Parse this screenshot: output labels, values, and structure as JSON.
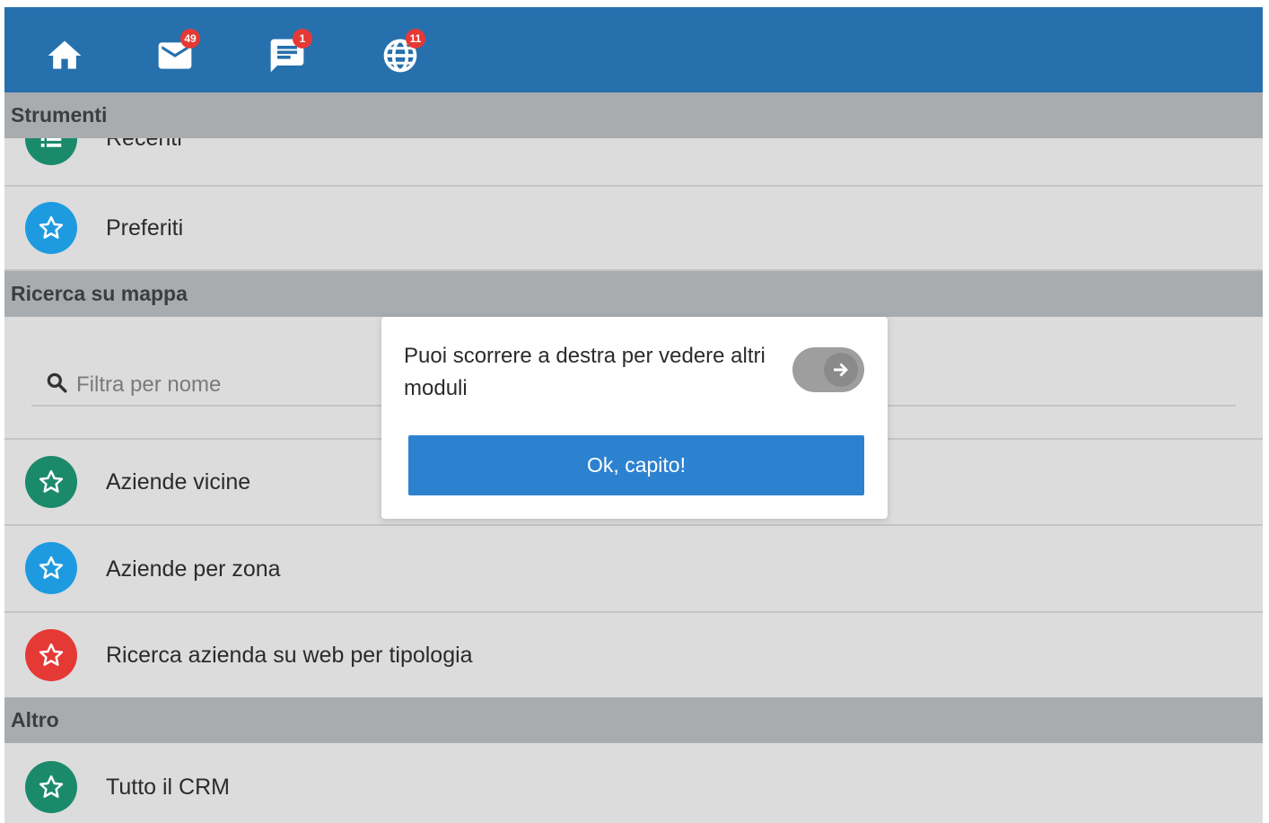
{
  "topbar": {
    "accent_color": "#2670ad",
    "icons": [
      {
        "name": "home-icon"
      },
      {
        "name": "mail-icon",
        "badge": "49"
      },
      {
        "name": "chat-icon",
        "badge": "1"
      },
      {
        "name": "globe-icon",
        "badge": "11"
      }
    ]
  },
  "sections": {
    "strumenti": {
      "title": "Strumenti",
      "items": [
        {
          "label": "Recenti",
          "icon": "list-icon",
          "color": "#1b8a6b"
        },
        {
          "label": "Preferiti",
          "icon": "star-icon",
          "color": "#1e9be0"
        }
      ]
    },
    "mappa": {
      "title": "Ricerca su mappa",
      "search_placeholder": "Filtra per nome",
      "items": [
        {
          "label": "Aziende vicine",
          "icon": "star-icon",
          "color": "#1b8a6b"
        },
        {
          "label": "Aziende per zona",
          "icon": "star-icon",
          "color": "#1e9be0"
        },
        {
          "label": "Ricerca azienda su web per tipologia",
          "icon": "star-icon",
          "color": "#e53935"
        }
      ]
    },
    "altro": {
      "title": "Altro",
      "items": [
        {
          "label": "Tutto il CRM",
          "icon": "star-icon",
          "color": "#1b8a6b"
        }
      ]
    }
  },
  "dialog": {
    "message": "Puoi scorrere a destra per vedere altri moduli",
    "button_label": "Ok, capito!",
    "button_color": "#2d82d0"
  }
}
